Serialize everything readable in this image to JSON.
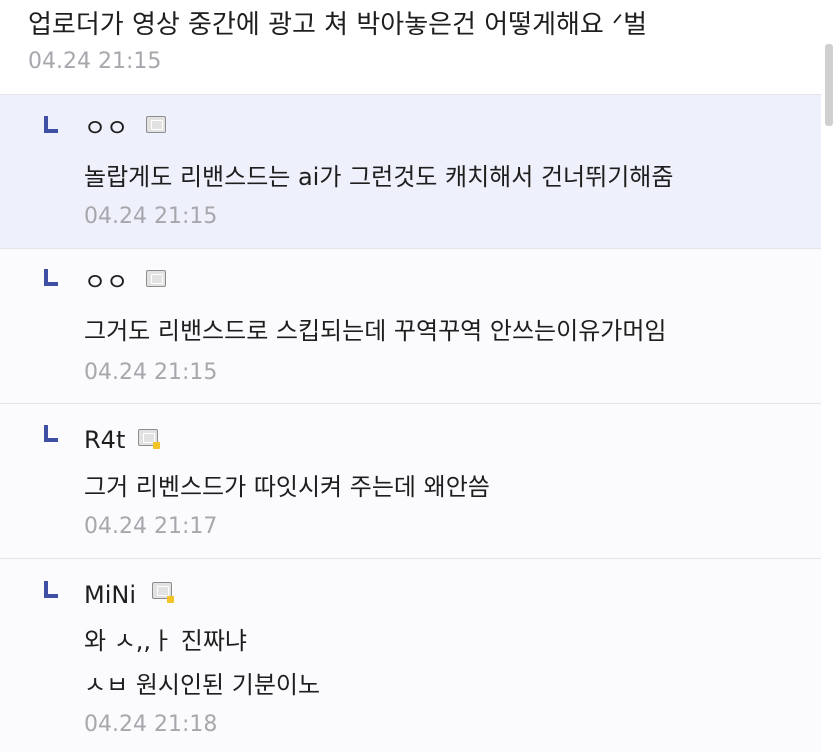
{
  "post": {
    "text": "업로더가 영상 중간에 광고 쳐 박아놓은건 어떻게해요 ᐟ벌",
    "timestamp": "04.24 21:15"
  },
  "replies": [
    {
      "author": "ㅇㅇ",
      "lines": [
        "놀랍게도 리밴스드는 ai가 그런것도 캐치해서 건너뛰기해줌"
      ],
      "timestamp": "04.24 21:15",
      "highlighted": true
    },
    {
      "author": "ㅇㅇ",
      "lines": [
        "그거도 리밴스드로 스킵되는데 꾸역꾸역 안쓰는이유가머임"
      ],
      "timestamp": "04.24 21:15",
      "highlighted": false
    },
    {
      "author": "R4t",
      "lines": [
        "그거 리벤스드가 따잇시켜 주는데 왜안씀"
      ],
      "timestamp": "04.24 21:17",
      "highlighted": false
    },
    {
      "author": "MiNi",
      "lines": [
        "와 ㅅ,,ㅏ 진짜냐",
        "ㅅㅂ 원시인된 기분이노"
      ],
      "timestamp": "04.24 21:18",
      "highlighted": false
    }
  ],
  "colors": {
    "reply_marker": "#3f4fa3",
    "highlight_bg": "#eef1fb",
    "timestamp": "#a7a7ad",
    "badge_dot": "#f3c325"
  }
}
